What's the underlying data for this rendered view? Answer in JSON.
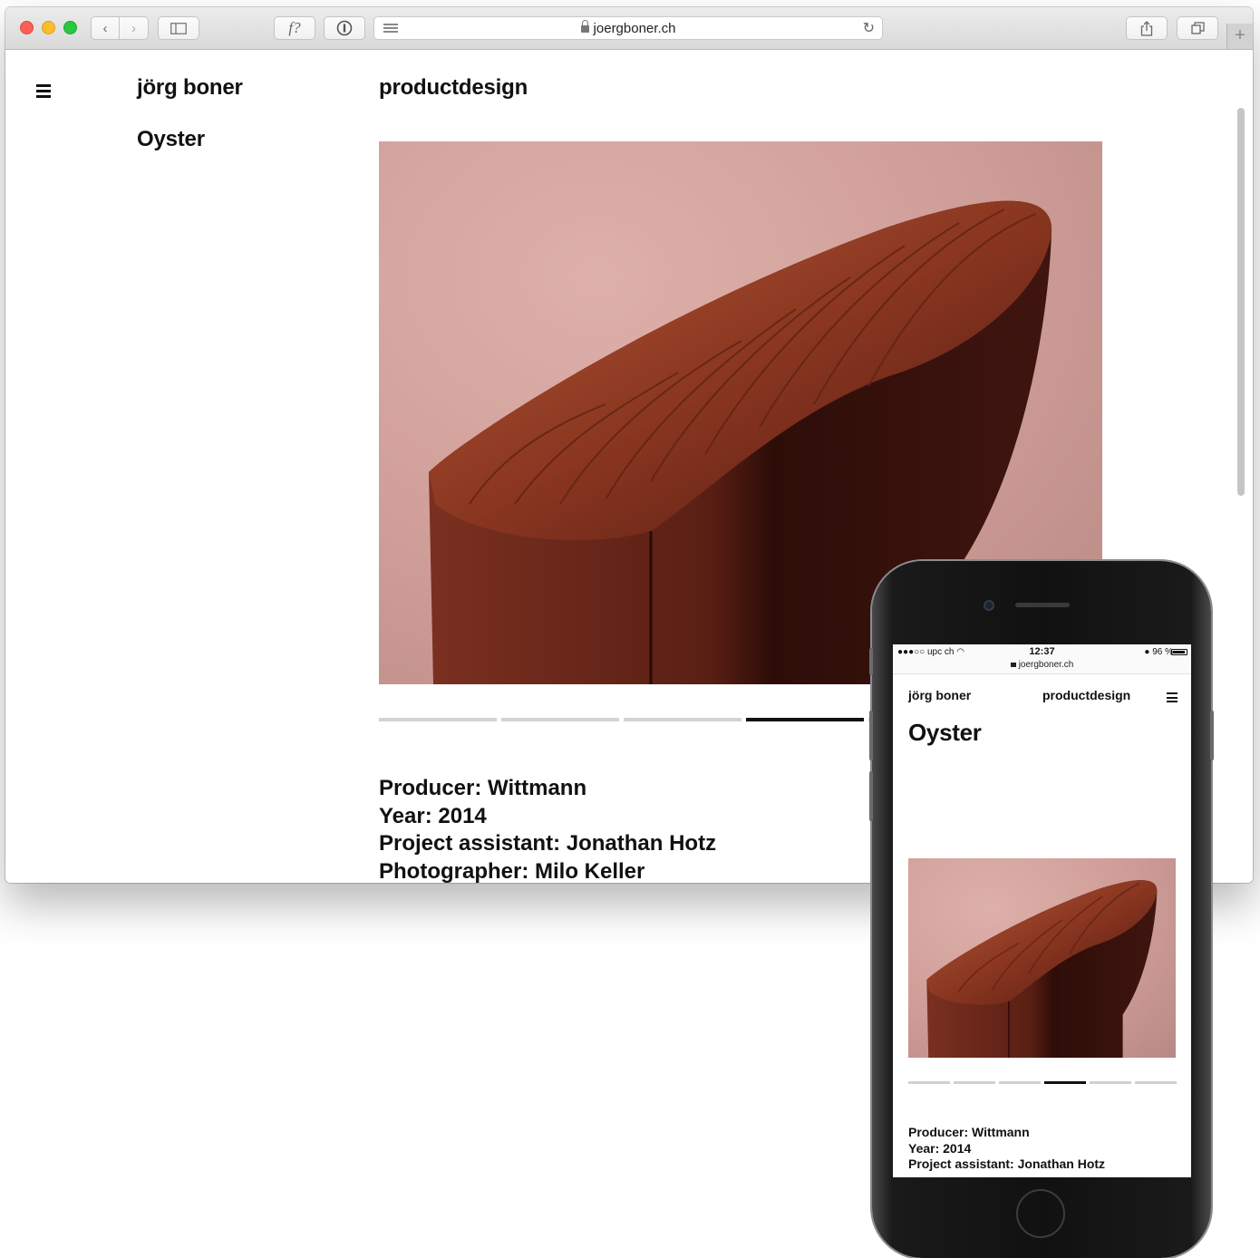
{
  "browser": {
    "url": "joergboner.ch",
    "font_button_label": "f?"
  },
  "page": {
    "site_name": "jörg boner",
    "section": "productdesign",
    "project_title": "Oyster",
    "slides": {
      "count": 6,
      "active_index": 3
    },
    "meta": [
      "Producer: Wittmann",
      "Year: 2014",
      "Project assistant: Jonathan Hotz",
      "Photographer: Milo Keller"
    ]
  },
  "phone": {
    "carrier": "●●●○○ upc ch",
    "time": "12:37",
    "battery": "96 %",
    "url": "joergboner.ch",
    "site_name": "jörg boner",
    "section": "productdesign",
    "project_title": "Oyster",
    "meta": [
      "Producer: Wittmann",
      "Year: 2014",
      "Project assistant: Jonathan Hotz"
    ]
  },
  "colors": {
    "backdrop": "#d4a39e",
    "leather": "#8a3a24",
    "active_slide": "#111111"
  },
  "icons": [
    "menu-icon",
    "back-icon",
    "forward-icon",
    "sidebar-icon",
    "password-icon",
    "reader-icon",
    "lock-icon",
    "reload-icon",
    "share-icon",
    "tabs-icon",
    "new-tab-icon",
    "wifi-icon",
    "alarm-icon",
    "battery-icon"
  ]
}
